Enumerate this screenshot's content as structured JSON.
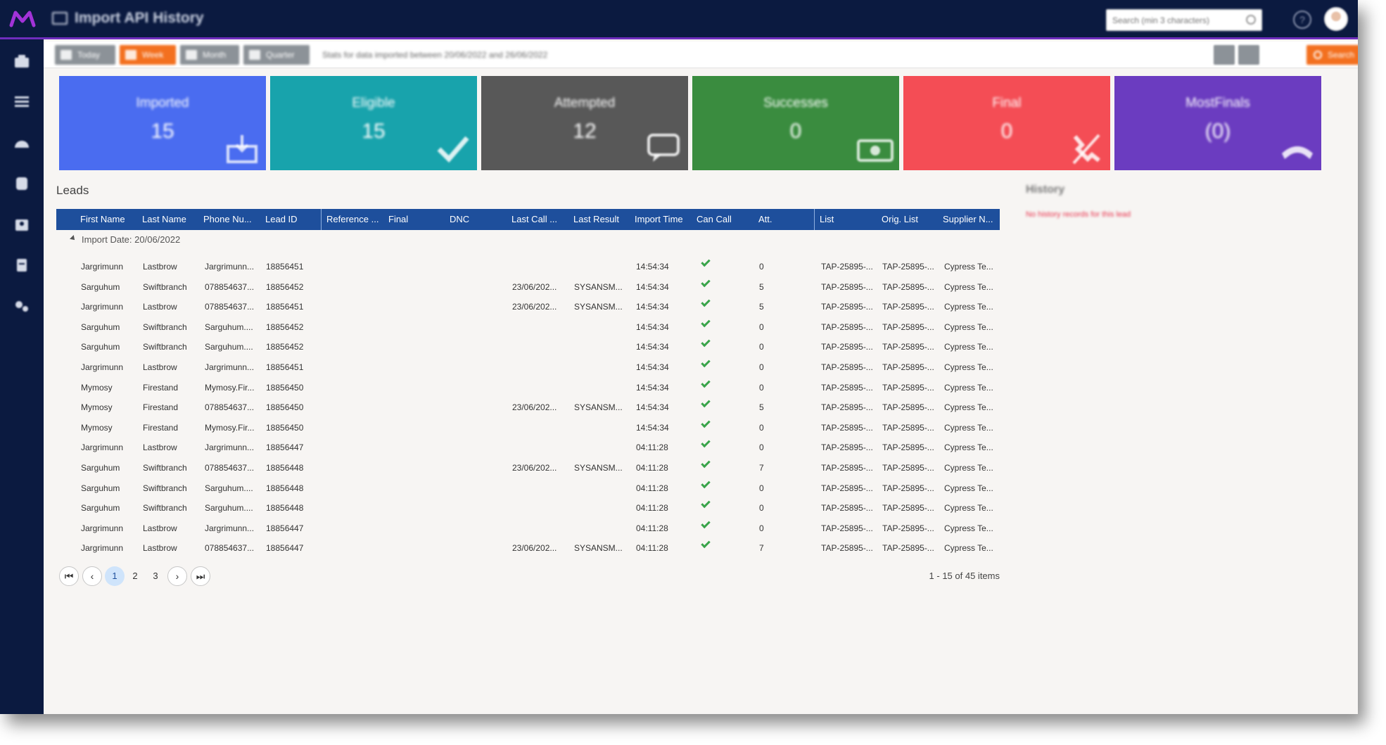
{
  "app": {
    "title": "Import API History",
    "search_placeholder": "Search (min 3 characters)",
    "brand_color": "#6f2dbd",
    "nav_color": "#0b1a40"
  },
  "sidebar": {
    "items": [
      {
        "icon": "home-icon"
      },
      {
        "icon": "list-icon"
      },
      {
        "icon": "dashboard-icon"
      },
      {
        "icon": "database-icon"
      },
      {
        "icon": "contacts-icon"
      },
      {
        "icon": "document-icon"
      },
      {
        "icon": "settings-icon"
      }
    ]
  },
  "toolbar": {
    "buttons": [
      {
        "label": "Today",
        "active": false
      },
      {
        "label": "Week",
        "active": true
      },
      {
        "label": "Month",
        "active": false
      },
      {
        "label": "Quarter",
        "active": false
      }
    ],
    "stats_text": "Stats for data imported between 20/06/2022 and 26/06/2022",
    "search_label": "Search"
  },
  "tiles": [
    {
      "label": "Imported",
      "value": "15",
      "color": "#4a6cf0",
      "icon": "import-icon"
    },
    {
      "label": "Eligible",
      "value": "15",
      "color": "#18a3ac",
      "icon": "check-icon"
    },
    {
      "label": "Attempted",
      "value": "12",
      "color": "#585858",
      "icon": "chat-icon"
    },
    {
      "label": "Successes",
      "value": "0",
      "color": "#3a8c3f",
      "icon": "money-icon"
    },
    {
      "label": "Final",
      "value": "0",
      "color": "#f44d55",
      "icon": "phone-off-icon"
    },
    {
      "label": "MostFinals",
      "value": "(0)",
      "color": "#6b3cc0",
      "icon": "hangup-icon"
    }
  ],
  "leads": {
    "title": "Leads",
    "columns": [
      "First Name",
      "Last Name",
      "Phone Nu...",
      "Lead ID",
      "Reference ...",
      "Final",
      "DNC",
      "Last Call ...",
      "Last Result",
      "Import Time",
      "Can Call",
      "Att.",
      "List",
      "Orig. List",
      "Supplier N..."
    ],
    "group_label": "Import Date: 20/06/2022",
    "rows": [
      [
        "Jargrimunn",
        "Lastbrow",
        "Jargrimunn...",
        "18856451",
        "",
        "",
        "",
        "",
        "",
        "14:54:34",
        true,
        "0",
        "TAP-25895-...",
        "TAP-25895-...",
        "Cypress Te..."
      ],
      [
        "Sarguhum",
        "Swiftbranch",
        "078854637...",
        "18856452",
        "",
        "",
        "",
        "23/06/202...",
        "SYSANSM...",
        "14:54:34",
        true,
        "5",
        "TAP-25895-...",
        "TAP-25895-...",
        "Cypress Te..."
      ],
      [
        "Jargrimunn",
        "Lastbrow",
        "078854637...",
        "18856451",
        "",
        "",
        "",
        "23/06/202...",
        "SYSANSM...",
        "14:54:34",
        true,
        "5",
        "TAP-25895-...",
        "TAP-25895-...",
        "Cypress Te..."
      ],
      [
        "Sarguhum",
        "Swiftbranch",
        "Sarguhum....",
        "18856452",
        "",
        "",
        "",
        "",
        "",
        "14:54:34",
        true,
        "0",
        "TAP-25895-...",
        "TAP-25895-...",
        "Cypress Te..."
      ],
      [
        "Sarguhum",
        "Swiftbranch",
        "Sarguhum....",
        "18856452",
        "",
        "",
        "",
        "",
        "",
        "14:54:34",
        true,
        "0",
        "TAP-25895-...",
        "TAP-25895-...",
        "Cypress Te..."
      ],
      [
        "Jargrimunn",
        "Lastbrow",
        "Jargrimunn...",
        "18856451",
        "",
        "",
        "",
        "",
        "",
        "14:54:34",
        true,
        "0",
        "TAP-25895-...",
        "TAP-25895-...",
        "Cypress Te..."
      ],
      [
        "Mymosy",
        "Firestand",
        "Mymosy.Fir...",
        "18856450",
        "",
        "",
        "",
        "",
        "",
        "14:54:34",
        true,
        "0",
        "TAP-25895-...",
        "TAP-25895-...",
        "Cypress Te..."
      ],
      [
        "Mymosy",
        "Firestand",
        "078854637...",
        "18856450",
        "",
        "",
        "",
        "23/06/202...",
        "SYSANSM...",
        "14:54:34",
        true,
        "5",
        "TAP-25895-...",
        "TAP-25895-...",
        "Cypress Te..."
      ],
      [
        "Mymosy",
        "Firestand",
        "Mymosy.Fir...",
        "18856450",
        "",
        "",
        "",
        "",
        "",
        "14:54:34",
        true,
        "0",
        "TAP-25895-...",
        "TAP-25895-...",
        "Cypress Te..."
      ],
      [
        "Jargrimunn",
        "Lastbrow",
        "Jargrimunn...",
        "18856447",
        "",
        "",
        "",
        "",
        "",
        "04:11:28",
        true,
        "0",
        "TAP-25895-...",
        "TAP-25895-...",
        "Cypress Te..."
      ],
      [
        "Sarguhum",
        "Swiftbranch",
        "078854637...",
        "18856448",
        "",
        "",
        "",
        "23/06/202...",
        "SYSANSM...",
        "04:11:28",
        true,
        "7",
        "TAP-25895-...",
        "TAP-25895-...",
        "Cypress Te..."
      ],
      [
        "Sarguhum",
        "Swiftbranch",
        "Sarguhum....",
        "18856448",
        "",
        "",
        "",
        "",
        "",
        "04:11:28",
        true,
        "0",
        "TAP-25895-...",
        "TAP-25895-...",
        "Cypress Te..."
      ],
      [
        "Sarguhum",
        "Swiftbranch",
        "Sarguhum....",
        "18856448",
        "",
        "",
        "",
        "",
        "",
        "04:11:28",
        true,
        "0",
        "TAP-25895-...",
        "TAP-25895-...",
        "Cypress Te..."
      ],
      [
        "Jargrimunn",
        "Lastbrow",
        "Jargrimunn...",
        "18856447",
        "",
        "",
        "",
        "",
        "",
        "04:11:28",
        true,
        "0",
        "TAP-25895-...",
        "TAP-25895-...",
        "Cypress Te..."
      ],
      [
        "Jargrimunn",
        "Lastbrow",
        "078854637...",
        "18856447",
        "",
        "",
        "",
        "23/06/202...",
        "SYSANSM...",
        "04:11:28",
        true,
        "7",
        "TAP-25895-...",
        "TAP-25895-...",
        "Cypress Te..."
      ]
    ],
    "header_color": "#1e4f9c"
  },
  "pager": {
    "pages": [
      "1",
      "2",
      "3"
    ],
    "current": "1",
    "items_text": "1 - 15 of 45 items"
  },
  "history": {
    "title": "History",
    "message": "No history records for this lead"
  }
}
